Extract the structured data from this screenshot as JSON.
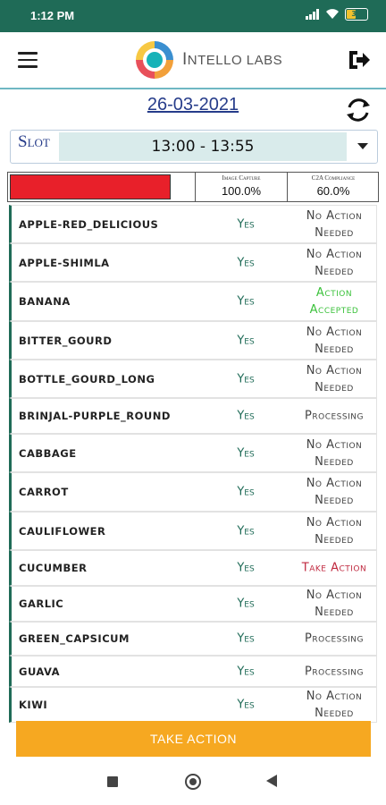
{
  "status_bar": {
    "time": "1:12 PM",
    "battery": "31"
  },
  "app": {
    "logo_text_first": "I",
    "logo_text_rest": "NTELLO LABS"
  },
  "date": "26-03-2021",
  "slot": {
    "label": "Slot",
    "value": "13:00 - 13:55"
  },
  "summary": {
    "image_capture_label": "Image Capture",
    "image_capture_value": "100.0%",
    "c2a_label": "C2A Compliance",
    "c2a_value": "60.0%",
    "progress_bar_color": "#e8202a"
  },
  "rows": [
    {
      "name": "APPLE-RED_DELICIOUS",
      "capture": "Yes",
      "action": "No Action\nNeeded",
      "status": "none"
    },
    {
      "name": "APPLE-SHIMLA",
      "capture": "Yes",
      "action": "No Action\nNeeded",
      "status": "none"
    },
    {
      "name": "BANANA",
      "capture": "Yes",
      "action": "Action\nAccepted",
      "status": "accepted"
    },
    {
      "name": "BITTER_GOURD",
      "capture": "Yes",
      "action": "No Action\nNeeded",
      "status": "none"
    },
    {
      "name": "BOTTLE_GOURD_LONG",
      "capture": "Yes",
      "action": "No Action\nNeeded",
      "status": "none"
    },
    {
      "name": "BRINJAL-PURPLE_ROUND",
      "capture": "Yes",
      "action": "Processing",
      "status": "processing"
    },
    {
      "name": "CABBAGE",
      "capture": "Yes",
      "action": "No Action\nNeeded",
      "status": "none"
    },
    {
      "name": "CARROT",
      "capture": "Yes",
      "action": "No Action\nNeeded",
      "status": "none"
    },
    {
      "name": "CAULIFLOWER",
      "capture": "Yes",
      "action": "No Action\nNeeded",
      "status": "none"
    },
    {
      "name": "CUCUMBER",
      "capture": "Yes",
      "action": "Take Action",
      "status": "take"
    },
    {
      "name": "GARLIC",
      "capture": "Yes",
      "action": "No Action\nNeeded",
      "status": "none"
    },
    {
      "name": "GREEN_CAPSICUM",
      "capture": "Yes",
      "action": "Processing",
      "status": "processing"
    },
    {
      "name": "GUAVA",
      "capture": "Yes",
      "action": "Processing",
      "status": "processing"
    },
    {
      "name": "KIWI",
      "capture": "Yes",
      "action": "No Action\nNeeded",
      "status": "none"
    }
  ],
  "take_action_button": "TAKE ACTION",
  "icons": [
    "menu-icon",
    "logout-icon",
    "refresh-icon",
    "dropdown-icon"
  ],
  "colors": {
    "header": "#1f6b57",
    "accent": "#f6a821",
    "accepted": "#3cc23c",
    "take": "#c02a40",
    "date": "#263c8a"
  }
}
